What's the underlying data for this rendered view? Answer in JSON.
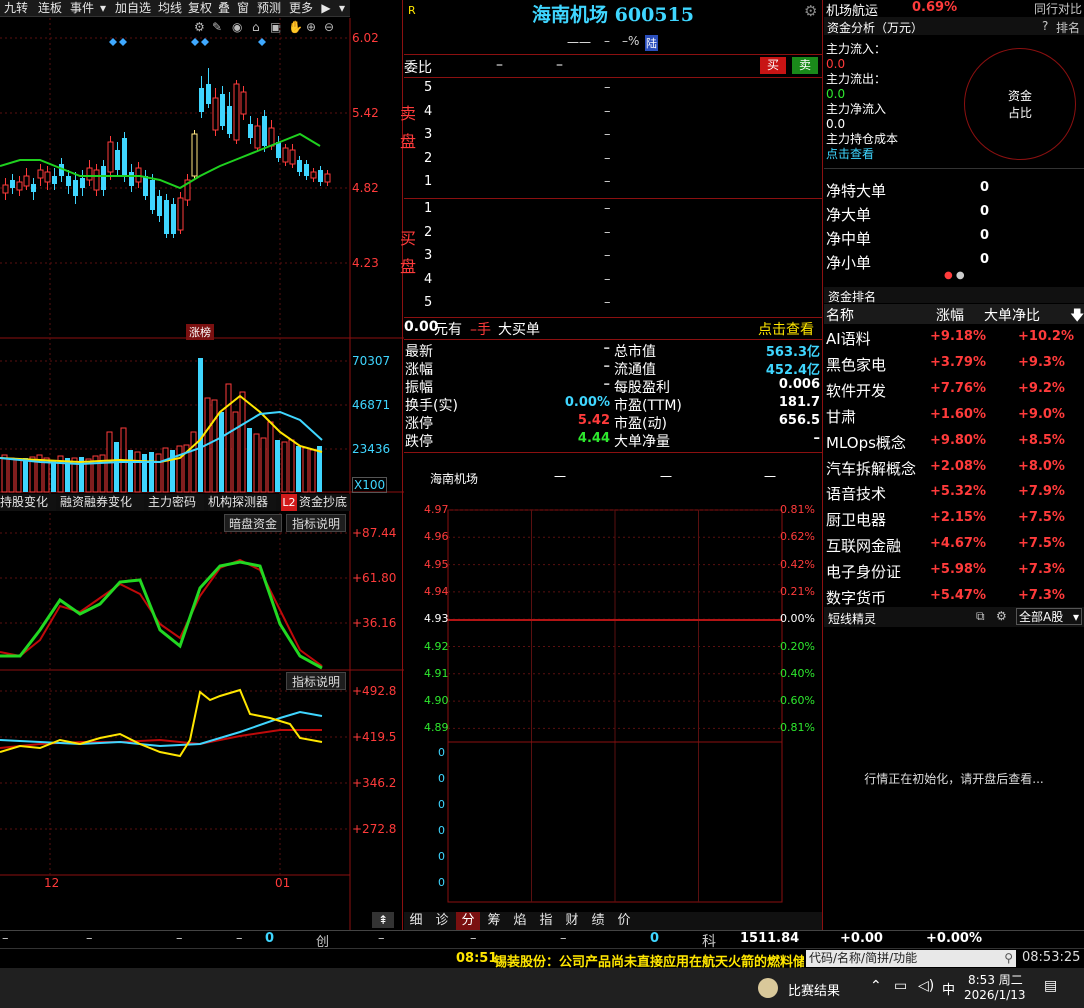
{
  "toolbar": {
    "items": [
      "九转",
      "连板",
      "事件",
      "",
      "加自选",
      "均线",
      "复权",
      "叠",
      "窗",
      "预测",
      "更多"
    ]
  },
  "kline": {
    "price_ticks": [
      "6.02",
      "5.42",
      "4.82",
      "4.23"
    ],
    "badge": "涨榜",
    "vol_ticks": [
      "70307",
      "46871",
      "23436"
    ],
    "vol_unit": "X100",
    "date_labels": [
      "12",
      "01"
    ]
  },
  "indicator_tabs": {
    "items": [
      "持股变化",
      "融资融券变化",
      "主力密码",
      "机构探测器",
      "资金抄底"
    ],
    "l2_badge": "L2",
    "right_buttons": [
      "暗盘资金",
      "指标说明"
    ],
    "ind2_button": "指标说明"
  },
  "ind1": {
    "ticks": [
      "+87.44",
      "+61.80",
      "+36.16"
    ]
  },
  "ind2": {
    "ticks": [
      "+492.8",
      "+419.5",
      "+346.2",
      "+272.8"
    ]
  },
  "quote": {
    "r_mark": "R",
    "title": "海南机场 600515",
    "sub_dash1": "一一",
    "sub_dash2": "–",
    "sub_pct": "–%",
    "sub_tag": "陆",
    "weibi_label": "委比",
    "weibi_v1": "–",
    "weibi_v2": "–",
    "sell_btn": "买",
    "buy_btn": "卖",
    "sell_label": "卖盘",
    "buy_label": "买盘",
    "sell_levels": [
      "5",
      "4",
      "3",
      "2",
      "1"
    ],
    "buy_levels": [
      "1",
      "2",
      "3",
      "4",
      "5"
    ],
    "level_dash": "–",
    "big_order_prefix": "0.00",
    "big_order_text1": "元有",
    "big_order_text2": "–手",
    "big_order_text3": "大买单",
    "big_order_link": "点击查看"
  },
  "stats": {
    "rows": [
      {
        "l1": "最新",
        "v1": "–",
        "l2": "总市值",
        "v2": "563.3亿"
      },
      {
        "l1": "涨幅",
        "v1": "–",
        "l2": "流通值",
        "v2": "452.4亿"
      },
      {
        "l1": "振幅",
        "v1": "–",
        "l2": "每股盈利",
        "v2": "0.006"
      },
      {
        "l1": "换手(实)",
        "v1": "0.00%",
        "l2": "市盈(TTM)",
        "v2": "181.7"
      },
      {
        "l1": "涨停",
        "v1": "5.42",
        "l2": "市盈(动)",
        "v2": "656.5"
      },
      {
        "l1": "跌停",
        "v1": "4.44",
        "l2": "大单净量",
        "v2": "–"
      }
    ]
  },
  "intraday": {
    "title": "海南机场",
    "dashes": [
      "一",
      "一",
      "一"
    ],
    "left_ticks": [
      "4.97",
      "4.96",
      "4.95",
      "4.94",
      "4.93",
      "4.92",
      "4.91",
      "4.90",
      "4.89"
    ],
    "right_ticks": [
      "0.81%",
      "0.62%",
      "0.42%",
      "0.21%",
      "0.00%",
      "0.20%",
      "0.40%",
      "0.60%",
      "0.81%"
    ],
    "vol_ticks": [
      "0",
      "0",
      "0",
      "0",
      "0",
      "0"
    ]
  },
  "bottom_tabs": [
    "细",
    "诊",
    "分",
    "筹",
    "焰",
    "指",
    "财",
    "绩",
    "价"
  ],
  "right_panel": {
    "sector_name": "机场航运",
    "sector_pct": "0.69%",
    "sector_tag": "同行对比",
    "fund_title": "资金分析（万元）",
    "fund_help": "?",
    "fund_rank": "排名",
    "inflow_label": "主力流入：",
    "inflow_value": "0.0",
    "outflow_label": "主力流出：",
    "outflow_value": "0.0",
    "net_label": "主力净流入",
    "net_value": "0.0",
    "cost_label": "主力持仓成本",
    "cost_link": "点击查看",
    "ring_text1": "资金",
    "ring_text2": "占比",
    "net_rows": [
      {
        "label": "净特大单",
        "value": "0"
      },
      {
        "label": "净大单",
        "value": "0"
      },
      {
        "label": "净中单",
        "value": "0"
      },
      {
        "label": "净小单",
        "value": "0"
      }
    ],
    "rank_title": "资金排名",
    "rank_headers": [
      "名称",
      "涨幅",
      "大单净比"
    ],
    "rank_rows": [
      {
        "name": "AI语料",
        "c1": "+9.18%",
        "c2": "+10.2%"
      },
      {
        "name": "黑色家电",
        "c1": "+3.79%",
        "c2": "+9.3%"
      },
      {
        "name": "软件开发",
        "c1": "+7.76%",
        "c2": "+9.2%"
      },
      {
        "name": "甘肃",
        "c1": "+1.60%",
        "c2": "+9.0%"
      },
      {
        "name": "MLOps概念",
        "c1": "+9.80%",
        "c2": "+8.5%"
      },
      {
        "name": "汽车拆解概念",
        "c1": "+2.08%",
        "c2": "+8.0%"
      },
      {
        "name": "语音技术",
        "c1": "+5.32%",
        "c2": "+7.9%"
      },
      {
        "name": "厨卫电器",
        "c1": "+2.15%",
        "c2": "+7.5%"
      },
      {
        "name": "互联网金融",
        "c1": "+4.67%",
        "c2": "+7.5%"
      },
      {
        "name": "电子身份证",
        "c1": "+5.98%",
        "c2": "+7.3%"
      },
      {
        "name": "数字货币",
        "c1": "+5.47%",
        "c2": "+7.3%"
      }
    ],
    "short_title": "短线精灵",
    "short_select": "全部A股",
    "short_msg": "行情正在初始化，请开盘后查看..."
  },
  "status_bar": {
    "d1": "–",
    "d2": "–",
    "d3": "–",
    "d4": "–",
    "v1": "0",
    "chuang": "创",
    "d5": "–",
    "d6": "–",
    "d7": "–",
    "v2": "0",
    "ke": "科",
    "ke_val": "1511.84",
    "ke_chg": "+0.00",
    "ke_pct": "+0.00%"
  },
  "news_bar": {
    "time": "08:51",
    "text": "锡装股份：公司产品尚未直接应用在航天火箭的燃料储",
    "search_placeholder": "代码/名称/简拼/功能",
    "clock": "08:53:25"
  },
  "taskbar": {
    "app_label": "比赛结果",
    "ime": "中",
    "time": "8:53 周二",
    "date": "2026/1/13"
  },
  "colors": {
    "up": "#ff3b3b",
    "down": "#2ee82e",
    "grid": "#8b1010",
    "cyan": "#3fd6ff",
    "yellow": "#ffe600"
  }
}
